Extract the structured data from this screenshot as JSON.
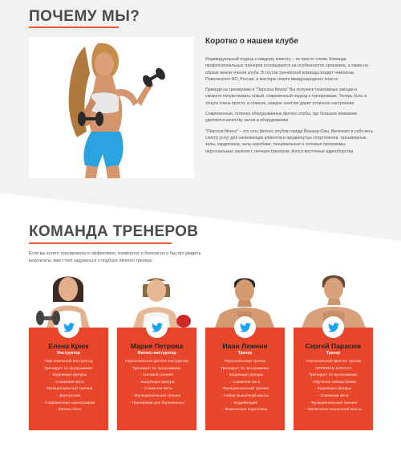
{
  "why": {
    "title": "ПОЧЕМУ МЫ?",
    "about_title": "Коротко о нашем клубе",
    "paragraphs": [
      "Индивидуальный подход к каждому клиенту – не просто слова. Команда профессиональных тренеров основывается на особенностях организма, а также на образе жизни членов клуба. В состав тренерской команды входят чемпионы Поволжского ФО, России, и мастера спорта международного класса",
      "Приходя на тренировки в \"Персона fitness\" Вы получите позитивные эмоции и сможете почувствовать новый, современный подход к тренировкам. Теперь быть в тонусе очень просто, а главное, каждое занятие дарит отличное настроение.",
      "Современные, отлично оборудованные фитнес клубы, где большое внимание уделяется качеству залов и оборудованию.",
      "\"Персона fitness\" – это сеть фитнес клубов города Йошкар-Олы. Включает в себя весь спектр услуг для начинающих клиентов и продвинутых спортсменов: тренажерные залы, кардиозона, залы аэробики, танцевальные и силовые программы, персональные занятия с личным тренером, йога и восточные единоборства"
    ]
  },
  "team": {
    "title": "КОМАНДА ТРЕНЕРОВ",
    "intro": "Если вы хотите тренироваться эффективно, комфортно и безопасно и быстро увидеть результаты, вам стоит задуматься о подборе личного тренера"
  },
  "trainers": [
    {
      "name": "Елена Крюк",
      "role": "Инструктор",
      "items": [
        "Персональный инструктор",
        "Тренирует по программам:",
        "- Коррекция фигуры",
        "- Снижение веса",
        "- Функциональный тренинг",
        "- Диетология",
        "- Современная хореография",
        "- Фитнес-йога"
      ]
    },
    {
      "name": "Мария Петрова",
      "role": "Фитнес-инструктор",
      "items": [
        "Персональный фитнес-инструктор",
        "Тренирует по программам:",
        "- Силовой тренинг",
        "- Коррекция фигуры",
        "- Снижение веса",
        "- Функциональный тренинг",
        "- Тренировки для беременных"
      ]
    },
    {
      "name": "Иван Лежнин",
      "role": "Тренер",
      "items": [
        "Персональный тренер",
        "Тренирует по программам:",
        "- Коррекция фигуры",
        "- Снижение веса",
        "- Функциональный тренинг",
        "- Набор мышечной массы",
        "- Бодибилдинг",
        "- Физическая подготовка"
      ]
    },
    {
      "name": "Сергей Парасюк",
      "role": "Тренер",
      "items": [
        "Персональный фитнес тренер",
        "ПРЕМИУМ КЛАССА",
        "Тренирует по программам:",
        "- Обучение новым базам",
        "- Коррекция фигуры",
        "- Снижение веса",
        "- Функциональный тренинг",
        "- Увеличение мышечной массы"
      ]
    }
  ],
  "colors": {
    "accent": "#e8462a",
    "underline": "#f05a3a",
    "twitter": "#1da1f2",
    "band": "#f2f2f2"
  },
  "icons": {
    "social": "twitter-icon"
  }
}
